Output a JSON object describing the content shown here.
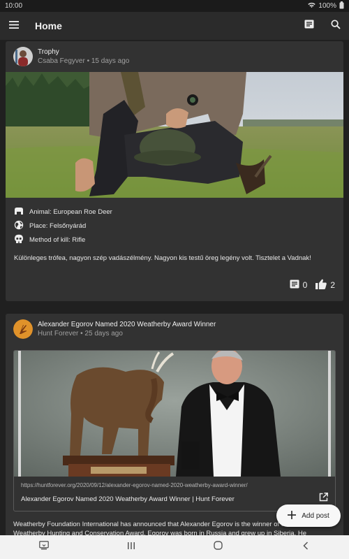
{
  "status_bar": {
    "time": "10:00",
    "battery": "100%"
  },
  "app_bar": {
    "title": "Home"
  },
  "posts": [
    {
      "title": "Trophy",
      "author": "Csaba Fegyver",
      "time_ago": "15 days ago",
      "facts": {
        "animal": "Animal: European Roe Deer",
        "place": "Place: Felsőnyárád",
        "method": "Method of kill: Rifle"
      },
      "text": "Különleges trófea, nagyon szép vadászélmény. Nagyon kis testű öreg legény volt. Tisztelet a Vadnak!",
      "comments": "0",
      "likes": "2"
    },
    {
      "title": "Alexander Egorov Named 2020 Weatherby Award Winner",
      "author": "Hunt Forever",
      "time_ago": "25 days ago",
      "link_url": "https://huntforever.org/2020/09/12/alexander-egorov-named-2020-weatherby-award-winner/",
      "link_title": "Alexander Egorov Named 2020 Weatherby Award Winner | Hunt Forever",
      "text": "Weatherby Foundation International has announced that Alexander Egorov is the winner of the 2020 Weatherby Hunting and Conservation Award. Egorov was born in Russia and grew up in Siberia. He"
    }
  ],
  "fab": {
    "label": "Add post"
  },
  "colors": {
    "background": "#202020",
    "card": "#323232",
    "app_bar": "#2b2b2b",
    "fab": "#f7f7f7"
  },
  "icons": [
    "wifi-icon",
    "battery-icon",
    "menu-icon",
    "feed-icon",
    "search-icon",
    "paw-icon",
    "globe-icon",
    "skull-icon",
    "comment-icon",
    "thumbs-up-icon",
    "external-link-icon",
    "plus-icon",
    "screenshot-icon",
    "recent-apps-icon",
    "home-icon",
    "back-icon"
  ]
}
